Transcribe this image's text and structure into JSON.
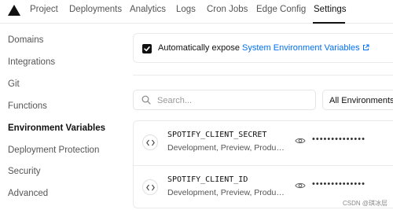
{
  "topnav": {
    "tabs": [
      {
        "label": "Project"
      },
      {
        "label": "Deployments"
      },
      {
        "label": "Analytics"
      },
      {
        "label": "Logs"
      },
      {
        "label": "Cron Jobs"
      },
      {
        "label": "Edge Config"
      },
      {
        "label": "Settings",
        "active": true
      }
    ]
  },
  "sidebar": {
    "items": [
      {
        "label": "Domains"
      },
      {
        "label": "Integrations"
      },
      {
        "label": "Git"
      },
      {
        "label": "Functions"
      },
      {
        "label": "Environment Variables",
        "active": true
      },
      {
        "label": "Deployment Protection"
      },
      {
        "label": "Security"
      },
      {
        "label": "Advanced"
      }
    ]
  },
  "expose": {
    "checked": true,
    "label": "Automatically expose",
    "link_label": "System Environment Variables",
    "link_icon": "external-link-icon"
  },
  "search": {
    "placeholder": "Search...",
    "value": ""
  },
  "environment_filter": {
    "selected": "All Environments"
  },
  "env_vars": [
    {
      "name": "SPOTIFY_CLIENT_SECRET",
      "targets": "Development, Preview, Production",
      "value_masked": "••••••••••••••"
    },
    {
      "name": "SPOTIFY_CLIENT_ID",
      "targets": "Development, Preview, Production",
      "value_masked": "••••••••••••••"
    }
  ],
  "watermark": "CSDN @琪冰层",
  "colors": {
    "link": "#0070f3",
    "text": "#111111",
    "muted": "#555555",
    "border": "#eaeaea"
  }
}
